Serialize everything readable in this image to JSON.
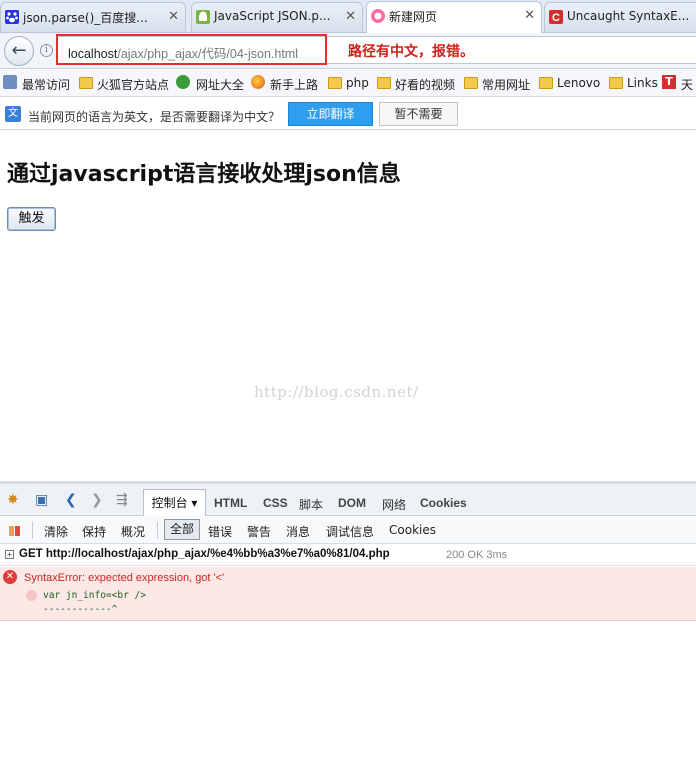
{
  "tabs": [
    {
      "label": "json.parse()_百度搜...",
      "icon": "baidu-paw-icon",
      "active": false
    },
    {
      "label": "JavaScript JSON.p...",
      "icon": "android-icon",
      "active": false
    },
    {
      "label": "新建网页",
      "icon": "firefox-new-tab-icon",
      "active": true
    },
    {
      "label": "Uncaught SyntaxE...",
      "icon": "csdn-icon",
      "active": false
    }
  ],
  "tab_close_glyph": "✕",
  "nav": {
    "url_host": "localhost",
    "url_path": "/ajax/php_ajax/代码/04-json.html",
    "annotation": "路径有中文，报错。"
  },
  "bookmarks": [
    "最常访问",
    "火狐官方站点",
    "网址大全",
    "新手上路",
    "php",
    "好看的视频",
    "常用网址",
    "Lenovo",
    "Links",
    "天"
  ],
  "translate_bar": {
    "message": "当前网页的语言为英文，是否需要翻译为中文？",
    "translate_button": "立即翻译",
    "not_now_button": "暂不需要"
  },
  "page": {
    "heading": "通过javascript语言接收处理json信息",
    "trigger_button": "触发",
    "watermark": "http://blog.csdn.net/"
  },
  "devtools": {
    "tabs": {
      "console": "控制台 ▾",
      "html": "HTML",
      "css": "CSS",
      "script": "脚本",
      "dom": "DOM",
      "net": "网络",
      "cookies": "Cookies"
    },
    "filters": {
      "clear": "清除",
      "persist": "保持",
      "profile": "概况",
      "all": "全部",
      "errors": "错误",
      "warnings": "警告",
      "info": "消息",
      "debug": "调试信息",
      "cookies": "Cookies"
    },
    "request": {
      "text": "GET http://localhost/ajax/php_ajax/%e4%bb%a3%e7%a0%81/04.php",
      "status": "200 OK 3ms"
    },
    "error": {
      "message": "SyntaxError: expected expression, got '<'",
      "source": "var jn_info=<br />",
      "marker": "------------^"
    }
  },
  "colors": {
    "annotation_red": "#d0201a",
    "translate_blue": "#2e9ef0",
    "error_red": "#c8261e",
    "error_bg": "#fde8e8"
  }
}
